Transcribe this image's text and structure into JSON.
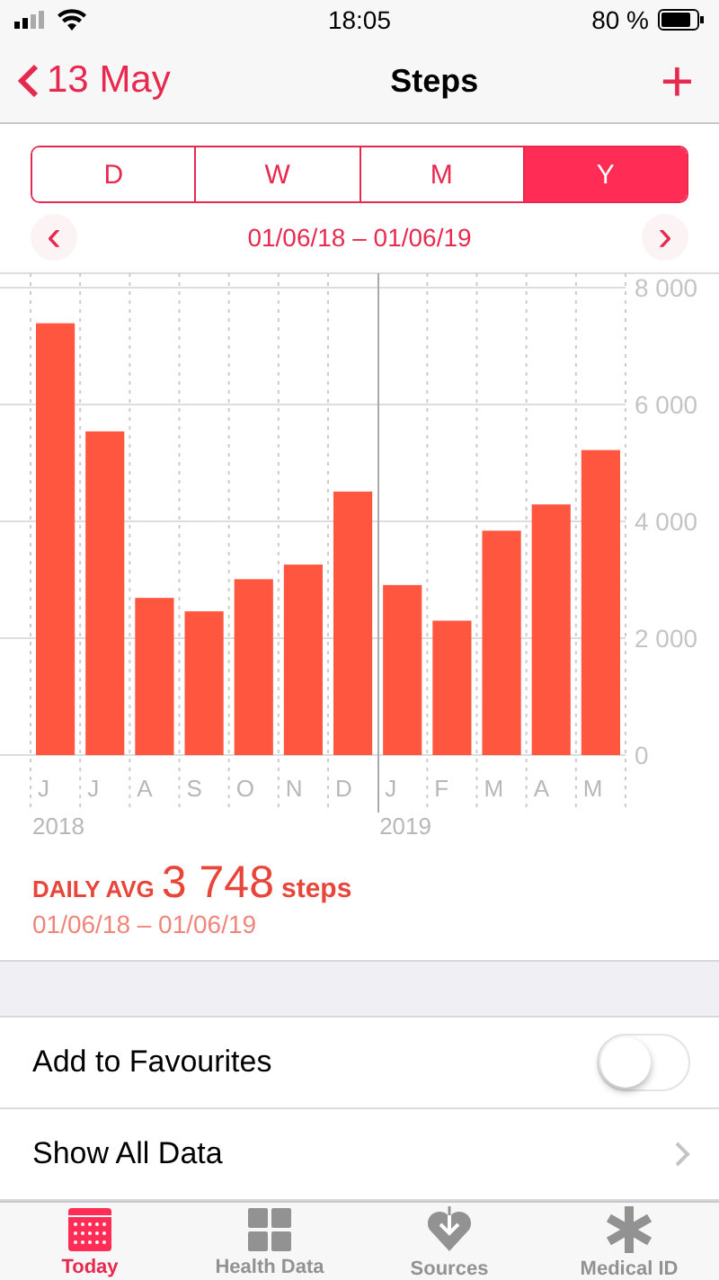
{
  "status_bar": {
    "time": "18:05",
    "battery": "80 %"
  },
  "nav": {
    "back": "13 May",
    "title": "Steps",
    "add": "+"
  },
  "segments": [
    {
      "label": "D",
      "selected": false
    },
    {
      "label": "W",
      "selected": false
    },
    {
      "label": "M",
      "selected": false
    },
    {
      "label": "Y",
      "selected": true
    }
  ],
  "range": {
    "prev": "‹",
    "label": "01/06/18 – 01/06/19",
    "next": "›"
  },
  "chart_data": {
    "type": "bar",
    "categories": [
      "J",
      "J",
      "A",
      "S",
      "O",
      "N",
      "D",
      "J",
      "F",
      "M",
      "A",
      "M"
    ],
    "grid": true,
    "series": [
      {
        "color": "#ff5640",
        "values": [
          7390,
          5540,
          2690,
          2460,
          3010,
          3260,
          4510,
          2910,
          2300,
          3840,
          4290,
          5220
        ]
      }
    ],
    "ylim": [
      0,
      8000
    ],
    "yticks": [
      {
        "value": 0,
        "label": "0"
      },
      {
        "value": 2000,
        "label": "2 000"
      },
      {
        "value": 4000,
        "label": "4 000"
      },
      {
        "value": 6000,
        "label": "6 000"
      },
      {
        "value": 8000,
        "label": "8 000"
      }
    ]
  },
  "year_labels": [
    "2018",
    "2019"
  ],
  "summary": {
    "label": "DAILY AVG",
    "value": "3 748",
    "unit": "steps",
    "range": "01/06/18 – 01/06/19"
  },
  "rows": [
    {
      "kind": "toggle",
      "label": "Add to Favourites",
      "on": false
    },
    {
      "kind": "link",
      "label": "Show All Data"
    }
  ],
  "tab_bar": [
    {
      "label": "Today",
      "selected": true
    },
    {
      "label": "Health Data",
      "selected": false
    },
    {
      "label": "Sources",
      "selected": false
    },
    {
      "label": "Medical ID",
      "selected": false
    }
  ]
}
